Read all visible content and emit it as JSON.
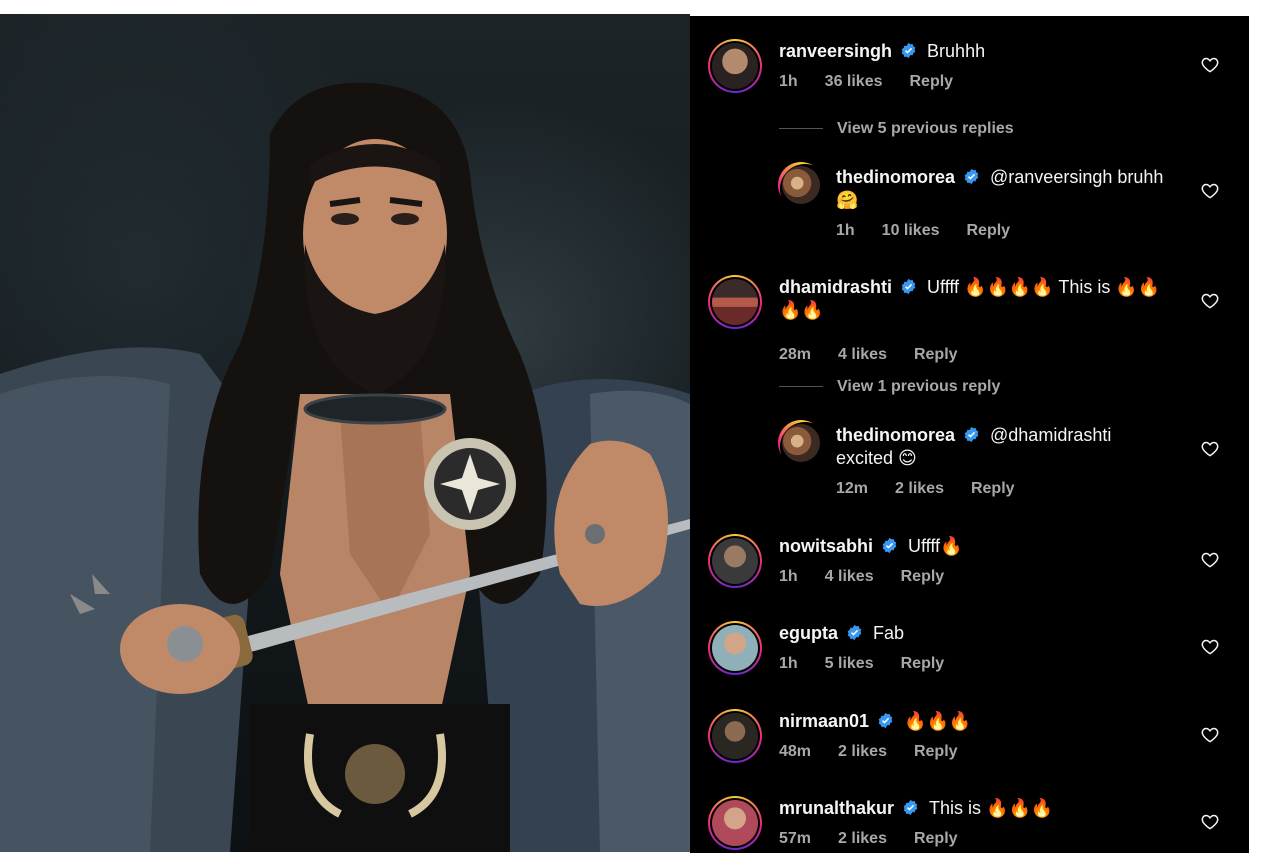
{
  "panel": {
    "background": "#000000",
    "meta_color": "#a8a8a8",
    "verified_color": "#3897f0",
    "reply_label": "Reply",
    "icons": {
      "verified": "verified-badge-icon",
      "like": "heart-outline-icon"
    }
  },
  "comments": [
    {
      "user": "ranveersingh",
      "text": "Bruhhh",
      "time": "1h",
      "likes": "36 likes"
    },
    {
      "view_replies": "View 5 previous replies"
    },
    {
      "user": "thedinomorea",
      "text": "@ranveersingh bruhh",
      "text2": "🤗",
      "time": "1h",
      "likes": "10 likes"
    },
    {
      "user": "dhamidrashti",
      "text": "Uffff 🔥🔥🔥🔥 This is 🔥🔥",
      "text2": "🔥🔥",
      "time": "28m",
      "likes": "4 likes"
    },
    {
      "view_replies": "View 1 previous reply"
    },
    {
      "user": "thedinomorea",
      "text": "@dhamidrashti",
      "text2": "excited 😊",
      "time": "12m",
      "likes": "2 likes"
    },
    {
      "user": "nowitsabhi",
      "text": "Uffff🔥",
      "time": "1h",
      "likes": "4 likes"
    },
    {
      "user": "egupta",
      "text": "Fab",
      "time": "1h",
      "likes": "5 likes"
    },
    {
      "user": "nirmaan01",
      "text": "🔥🔥🔥",
      "time": "48m",
      "likes": "2 likes"
    },
    {
      "user": "mrunalthakur",
      "text": "This is 🔥🔥🔥",
      "time": "57m",
      "likes": "2 likes"
    }
  ]
}
